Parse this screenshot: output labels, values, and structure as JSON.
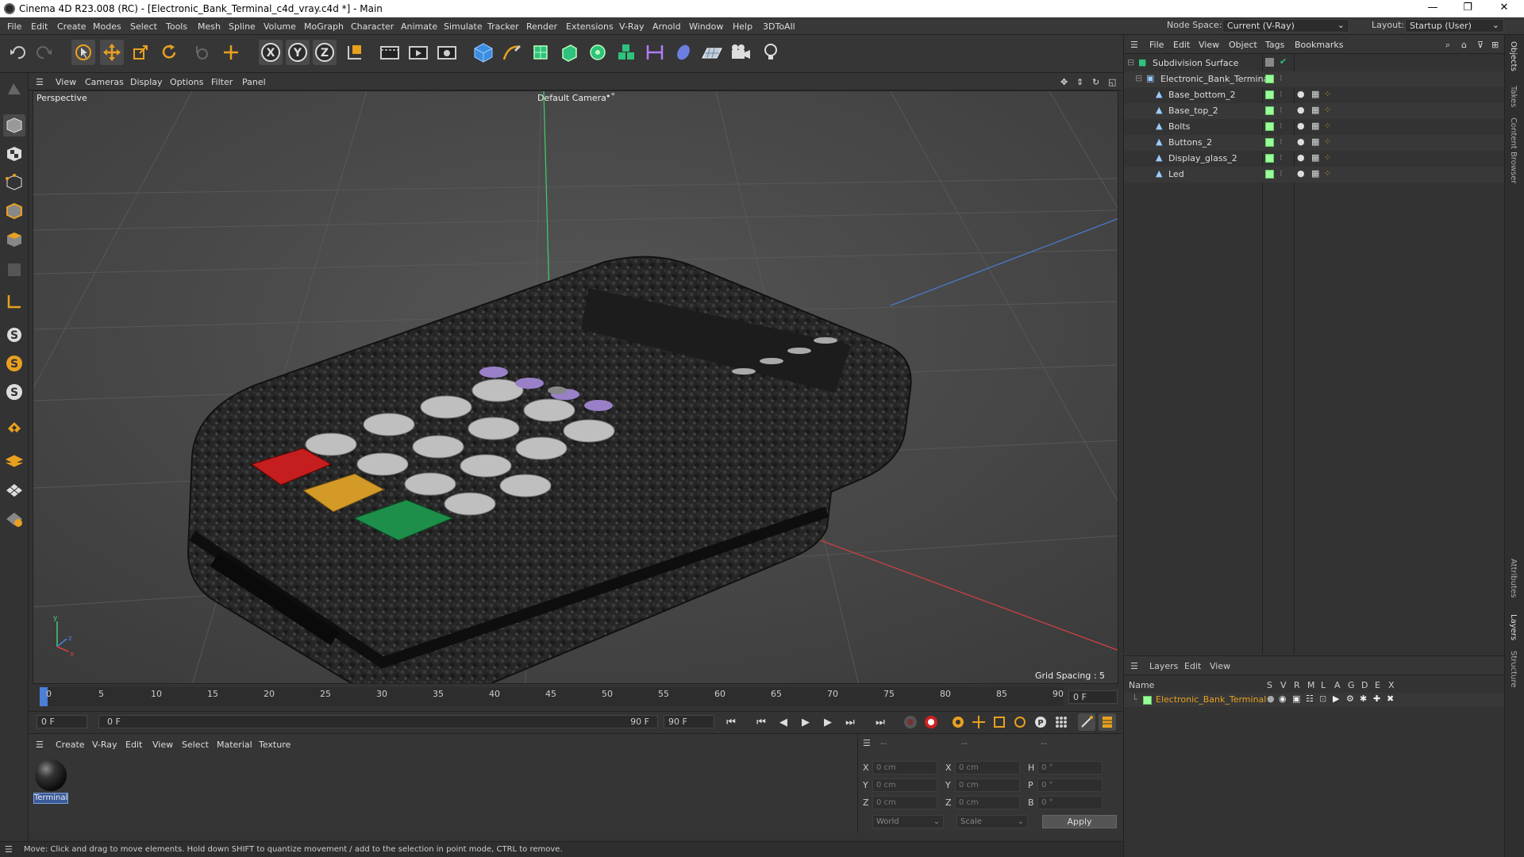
{
  "window": {
    "title": "Cinema 4D R23.008 (RC) - [Electronic_Bank_Terminal_c4d_vray.c4d *] - Main",
    "minimize": "—",
    "maximize": "❐",
    "close": "✕"
  },
  "menu": [
    "File",
    "Edit",
    "Create",
    "Modes",
    "Select",
    "Tools",
    "Mesh",
    "Spline",
    "Volume",
    "MoGraph",
    "Character",
    "Animate",
    "Simulate",
    "Tracker",
    "Render",
    "Extensions",
    "V-Ray",
    "Arnold",
    "Window",
    "Help",
    "3DToAll"
  ],
  "node_space": {
    "label": "Node Space:",
    "value": "Current (V-Ray)"
  },
  "layout": {
    "label": "Layout:",
    "value": "Startup (User)"
  },
  "viewport": {
    "menu": [
      "View",
      "Cameras",
      "Display",
      "Options",
      "Filter",
      "Panel"
    ],
    "label": "Perspective",
    "camera": "Default Camera",
    "camera_icon": "•°",
    "grid_spacing": "Grid Spacing : 5 cm"
  },
  "timeline": {
    "ticks": [
      "0",
      "5",
      "10",
      "15",
      "20",
      "25",
      "30",
      "35",
      "40",
      "45",
      "50",
      "55",
      "60",
      "65",
      "70",
      "75",
      "80",
      "85",
      "90"
    ],
    "current_frame": "0 F",
    "start": "0 F",
    "range_start": "0 F",
    "range_end": "90 F",
    "end": "90 F"
  },
  "material_panel": {
    "menu": [
      "Create",
      "V-Ray",
      "Edit",
      "View",
      "Select",
      "Material",
      "Texture"
    ],
    "material_name": "Terminal"
  },
  "coords": {
    "headers": [
      "--",
      "--",
      "--"
    ],
    "rows": [
      {
        "a": "X",
        "av": "0 cm",
        "b": "X",
        "bv": "0 cm",
        "c": "H",
        "cv": "0 °"
      },
      {
        "a": "Y",
        "av": "0 cm",
        "b": "Y",
        "bv": "0 cm",
        "c": "P",
        "cv": "0 °"
      },
      {
        "a": "Z",
        "av": "0 cm",
        "b": "Z",
        "bv": "0 cm",
        "c": "B",
        "cv": "0 °"
      }
    ],
    "world": "World",
    "scale": "Scale",
    "apply": "Apply"
  },
  "object_panel": {
    "menu": [
      "File",
      "Edit",
      "View",
      "Object",
      "Tags",
      "Bookmarks"
    ],
    "objects": [
      {
        "name": "Subdivision Surface"
      },
      {
        "name": "Electronic_Bank_Terminal"
      },
      {
        "name": "Base_bottom_2"
      },
      {
        "name": "Base_top_2"
      },
      {
        "name": "Bolts"
      },
      {
        "name": "Buttons_2"
      },
      {
        "name": "Display_glass_2"
      },
      {
        "name": "Led"
      }
    ]
  },
  "layer_panel": {
    "menu": [
      "Layers",
      "Edit",
      "View"
    ],
    "name_header": "Name",
    "flags": [
      "S",
      "V",
      "R",
      "M",
      "L",
      "A",
      "G",
      "D",
      "E",
      "X"
    ],
    "layer_name": "Electronic_Bank_Terminal",
    "layer_color": "#e8a020"
  },
  "right_tabs": [
    "Objects",
    "Takes",
    "Content Browser",
    "Attributes",
    "Layers",
    "Structure"
  ],
  "status": "Move: Click and drag to move elements. Hold down SHIFT to quantize movement / add to the selection in point mode, CTRL to remove."
}
